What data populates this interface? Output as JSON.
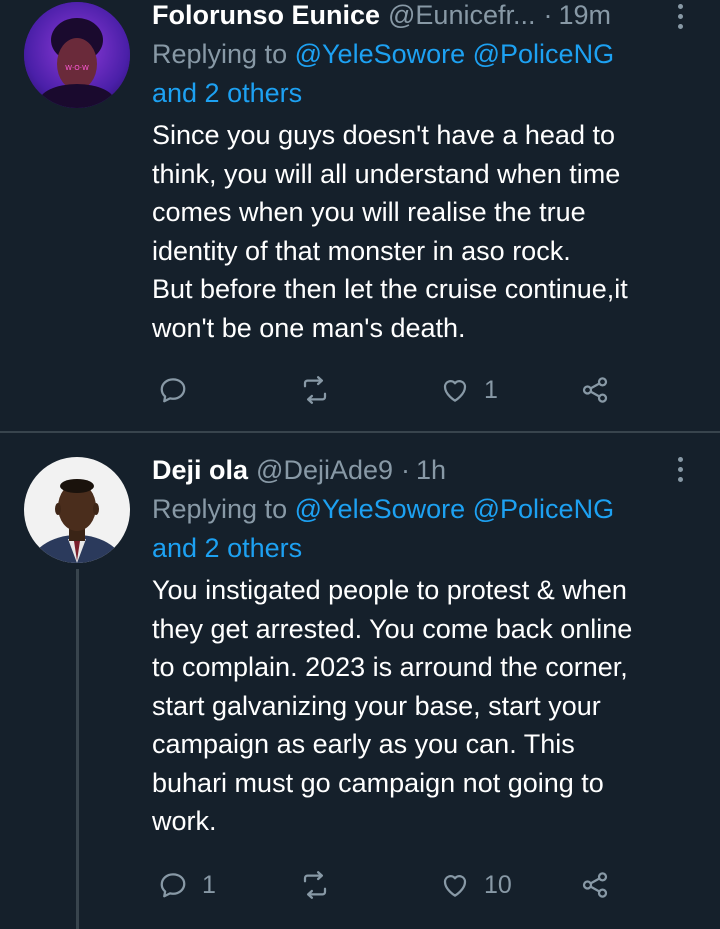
{
  "tweets": [
    {
      "name": "Folorunso Eunice",
      "handle": "@Eunicefr...",
      "dot": "·",
      "time": "19m",
      "replying_prefix": "Replying to",
      "replying_mentions": "@YeleSowore @PoliceNG",
      "replying_others": "and 2 others",
      "text": "Since you guys doesn't have a head to\nthink, you will all understand when time\ncomes when you will realise the true\nidentity of that monster in aso rock.\nBut before then let the cruise continue,it\nwon't be one man's death.",
      "reply_count": "",
      "retweet_count": "",
      "like_count": "1",
      "avatar_logo_text": "W·O·W"
    },
    {
      "name": "Deji ola",
      "handle": "@DejiAde9",
      "dot": "·",
      "time": "1h",
      "replying_prefix": "Replying to",
      "replying_mentions": "@YeleSowore @PoliceNG",
      "replying_others": "and 2 others",
      "text": "You instigated people to protest & when\nthey get arrested.  You come back online\nto complain. 2023 is arround the corner,\nstart galvanizing your base, start your\ncampaign as early as you can. This\nbuhari must go campaign not going to\nwork.",
      "reply_count": "1",
      "retweet_count": "",
      "like_count": "10"
    }
  ],
  "icons": {
    "reply": "reply-icon",
    "retweet": "retweet-icon",
    "like": "heart-icon",
    "share": "share-icon",
    "more": "more-vertical-icon"
  },
  "colors": {
    "background": "#15202b",
    "divider": "#38444d",
    "secondary_text": "#8899a6",
    "link": "#1da1f2",
    "primary_text": "#ffffff"
  }
}
